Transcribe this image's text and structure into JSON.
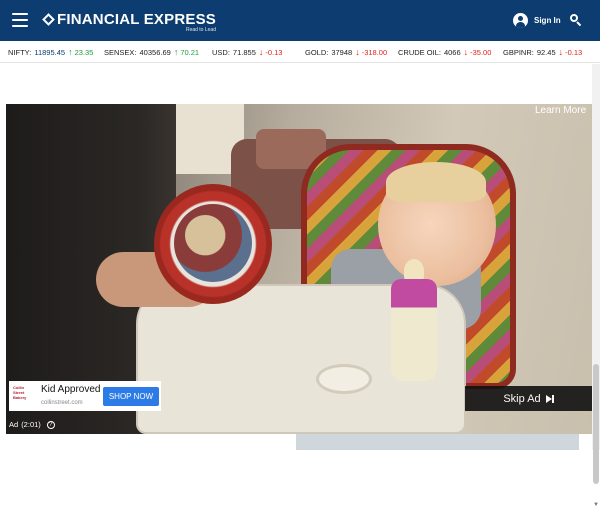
{
  "header": {
    "logo_text": "FINANCIAL EXPRESS",
    "tagline": "Read to Lead",
    "signin_label": "Sign In"
  },
  "ticker": [
    {
      "name": "NIFTY:",
      "value": "11895.45",
      "direction": "up",
      "change": "23.35"
    },
    {
      "name": "SENSEX:",
      "value": "40356.69",
      "direction": "up",
      "change": "70.21"
    },
    {
      "name": "USD:",
      "value": "71.855",
      "direction": "down",
      "change": "-0.13"
    },
    {
      "name": "GOLD:",
      "value": "37948",
      "direction": "down",
      "change": "-318.00"
    },
    {
      "name": "CRUDE OIL:",
      "value": "4066",
      "direction": "down",
      "change": "-35.00"
    },
    {
      "name": "GBPINR:",
      "value": "92.45",
      "direction": "down",
      "change": "-0.13"
    }
  ],
  "video_ad": {
    "learn_more": "Learn More",
    "card_title": "Kid Approved",
    "card_url": "collinstreet.com",
    "card_logo_lines": [
      "Collin",
      "Street",
      "Bakery"
    ],
    "shop_button": "SHOP NOW",
    "skip_button": "Skip Ad",
    "ad_label": "Ad",
    "ad_time": "(2:01)",
    "info_symbol": "?"
  },
  "colors": {
    "header_bg": "#0c3c70",
    "up": "#1f9d3a",
    "down": "#e0221c",
    "shop_button": "#2d7be6"
  },
  "icons": [
    "hamburger-icon",
    "user-icon",
    "search-icon",
    "arrow-up-icon",
    "arrow-down-icon",
    "skip-icon",
    "info-icon"
  ]
}
